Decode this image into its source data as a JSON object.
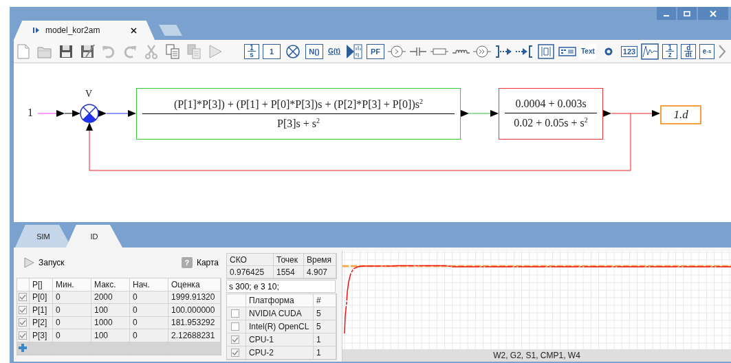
{
  "document_tabs": [
    {
      "title": "model_kor2am",
      "selected": true
    }
  ],
  "toolbar": {
    "file_tools": [
      {
        "kind": "new"
      },
      {
        "kind": "open"
      },
      {
        "kind": "save"
      },
      {
        "kind": "save-as"
      },
      {
        "kind": "undo"
      },
      {
        "kind": "redo"
      },
      {
        "kind": "cut"
      },
      {
        "kind": "copy"
      },
      {
        "kind": "paste"
      },
      {
        "kind": "run"
      }
    ],
    "palette": [
      {
        "kind": "fraction",
        "num": "1",
        "den": "s"
      },
      {
        "kind": "box",
        "label": "1"
      },
      {
        "kind": "sum"
      },
      {
        "kind": "box",
        "label": "N()"
      },
      {
        "kind": "arrow",
        "label": "G(t)"
      },
      {
        "kind": "scope"
      },
      {
        "kind": "box",
        "label": "PF"
      },
      {
        "kind": "comparator"
      },
      {
        "kind": "capacitor"
      },
      {
        "kind": "resistor"
      },
      {
        "kind": "inductor"
      },
      {
        "kind": "amplifier"
      },
      {
        "kind": "port-out"
      },
      {
        "kind": "port-in"
      },
      {
        "kind": "transformer"
      },
      {
        "kind": "table"
      },
      {
        "kind": "text",
        "label": "Text"
      },
      {
        "kind": "point"
      },
      {
        "kind": "display",
        "label": "123"
      },
      {
        "kind": "wave"
      },
      {
        "kind": "fraction",
        "num": "1",
        "den": "z"
      },
      {
        "kind": "fraction",
        "num": "d",
        "den": "dt"
      },
      {
        "kind": "exp",
        "label": "e",
        "sup": "-s"
      },
      {
        "kind": "more"
      }
    ]
  },
  "diagram": {
    "input_value": "1",
    "sum_label": "V",
    "blocks": [
      {
        "color": "#33cc33",
        "numerator": [
          {
            "text": "(P[1]*P[3]) + (P[1] + P[0]*P[3])s + (P[2]*P[3] + P[0])s",
            "sup": "2"
          }
        ],
        "denominator": [
          {
            "text": "P[3]s + s",
            "sup": "2"
          }
        ]
      },
      {
        "color": "#ee3333",
        "numerator": [
          {
            "text": "0.0004 + 0.003s"
          }
        ],
        "denominator": [
          {
            "text": "0.02 + 0.05s + s",
            "sup": "2"
          }
        ]
      }
    ],
    "output": {
      "label": "1.d"
    }
  },
  "bottom_tabs": [
    {
      "label": "SIM",
      "selected": false
    },
    {
      "label": "ID",
      "selected": true
    }
  ],
  "id_panel": {
    "run_button": "Запуск",
    "map_button": {
      "icon": "?",
      "label": "Карта"
    },
    "params_table": {
      "columns": [
        "P[]",
        "Мин.",
        "Макс.",
        "Нач.",
        "Оценка"
      ],
      "rows": [
        {
          "checked": true,
          "cells": [
            "P[0]",
            "0",
            "2000",
            "0",
            "1999.91320"
          ]
        },
        {
          "checked": true,
          "cells": [
            "P[1]",
            "0",
            "100",
            "0",
            "100.000000"
          ]
        },
        {
          "checked": true,
          "cells": [
            "P[2]",
            "0",
            "1000",
            "0",
            "181.953292"
          ]
        },
        {
          "checked": true,
          "cells": [
            "P[3]",
            "0",
            "100",
            "0",
            "2.12688231"
          ]
        }
      ]
    },
    "stats": {
      "columns": [
        "СКО",
        "Точек",
        "Время"
      ],
      "values": [
        "0.976425",
        "1554",
        "4.907"
      ]
    },
    "options_field": {
      "value": "s 300; e 3 10;"
    },
    "platforms": {
      "columns": [
        "Платформа",
        "#"
      ],
      "rows": [
        {
          "checked": false,
          "cells": [
            "NVIDIA CUDA",
            "5"
          ]
        },
        {
          "checked": false,
          "cells": [
            "Intel(R) OpenCL",
            "5"
          ]
        },
        {
          "checked": true,
          "cells": [
            "CPU-1",
            "1"
          ]
        },
        {
          "checked": true,
          "cells": [
            "CPU-2",
            "1"
          ]
        }
      ]
    },
    "chart": {
      "legend": "W2, G2, S1, CMP1, W4"
    }
  }
}
